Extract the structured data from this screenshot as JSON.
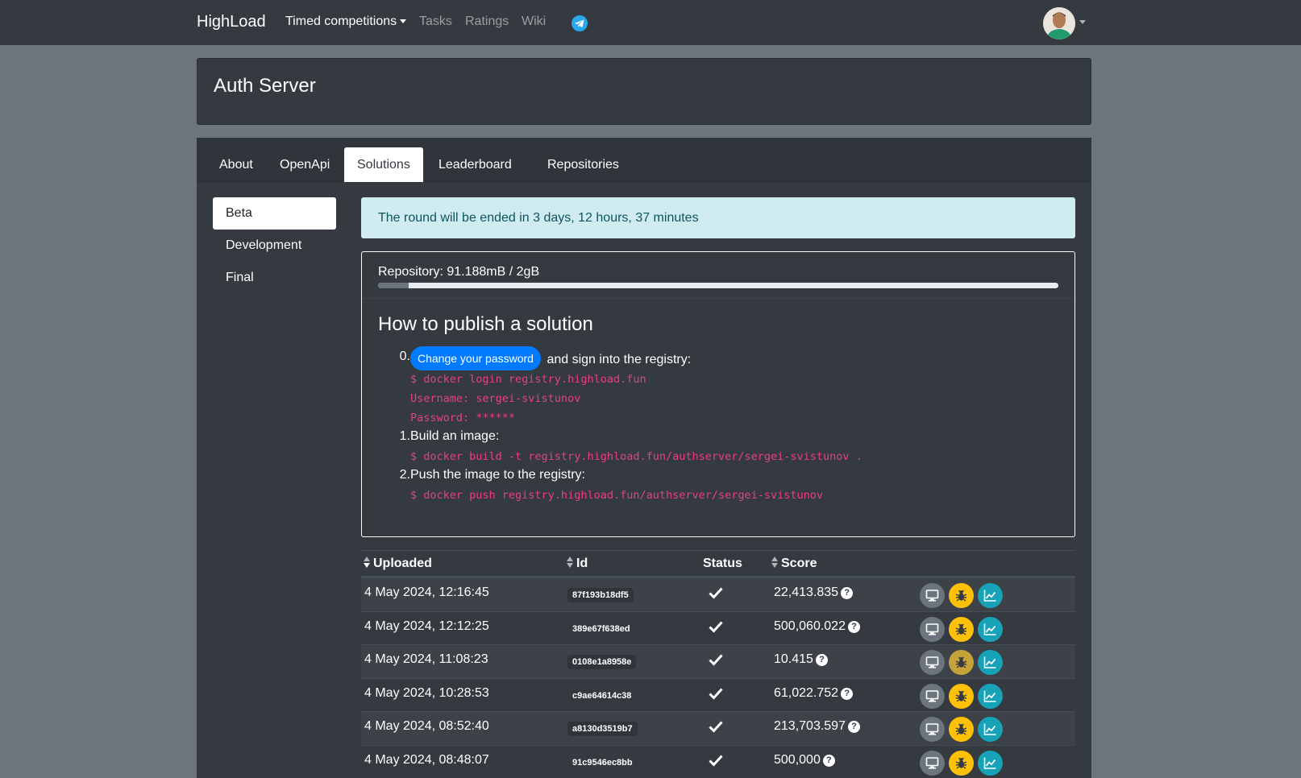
{
  "navbar": {
    "brand": "HighLoad",
    "links": [
      {
        "label": "Timed competitions",
        "dropdown": true
      },
      {
        "label": "Tasks"
      },
      {
        "label": "Ratings"
      },
      {
        "label": "Wiki"
      }
    ]
  },
  "header": {
    "title": "Auth Server"
  },
  "tabs": [
    "About",
    "OpenApi",
    "Solutions",
    "Leaderboard",
    "Repositories"
  ],
  "active_tab": "Solutions",
  "sidebar": {
    "items": [
      "Beta",
      "Development",
      "Final"
    ],
    "active": "Beta"
  },
  "alert": {
    "text": "The round will be ended in 3 days, 12 hours, 37 minutes"
  },
  "repository": {
    "label": "Repository: 91.188mB / 2gB",
    "used_fraction": 0.045
  },
  "publish": {
    "title": "How to publish a solution",
    "step0_num": "0.",
    "step0_button": "Change your password",
    "step0_text": "and sign into the registry:",
    "step0_code": [
      "$ docker login registry.highload.fun",
      "Username: sergei-svistunov",
      "Password: ******"
    ],
    "step1_num": "1.",
    "step1_text": "Build an image:",
    "step1_code": "$ docker build -t registry.highload.fun/authserver/sergei-svistunov .",
    "step2_num": "2.",
    "step2_text": "Push the image to the registry:",
    "step2_code": "$ docker push registry.highload.fun/authserver/sergei-svistunov"
  },
  "table": {
    "headers": {
      "uploaded": "Uploaded",
      "id": "Id",
      "status": "Status",
      "score": "Score"
    },
    "rows": [
      {
        "uploaded": "4 May 2024, 12:16:45",
        "id": "87f193b18df5",
        "score": "22,413.835"
      },
      {
        "uploaded": "4 May 2024, 12:12:25",
        "id": "389e67f638ed",
        "score": "500,060.022"
      },
      {
        "uploaded": "4 May 2024, 11:08:23",
        "id": "0108e1a8958e",
        "score": "10.415"
      },
      {
        "uploaded": "4 May 2024, 10:28:53",
        "id": "c9ae64614c38",
        "score": "61,022.752"
      },
      {
        "uploaded": "4 May 2024, 08:52:40",
        "id": "a8130d3519b7",
        "score": "213,703.597"
      },
      {
        "uploaded": "4 May 2024, 08:48:07",
        "id": "91c9546ec8bb",
        "score": "500,000"
      }
    ]
  },
  "colors": {
    "navbar": "#343a40",
    "page_bg": "#6c757d",
    "primary": "#007bff",
    "warning": "#ffc107",
    "info": "#17a2b8",
    "code": "#e83e8c"
  }
}
